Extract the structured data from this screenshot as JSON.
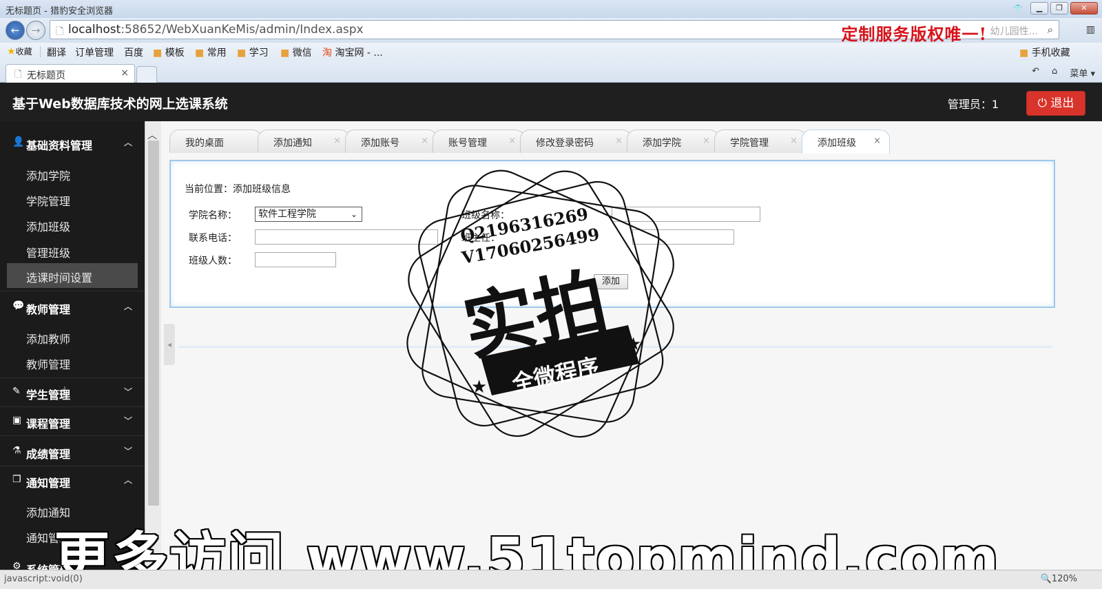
{
  "browser": {
    "window_title": "无标题页 - 猎豹安全浏览器",
    "url_host": "localhost",
    "url_rest": ":58652/WebXuanKeMis/admin/Index.aspx",
    "promo_text": "定制服务版权唯一!",
    "search_hint": "幼儿园性...",
    "favorites": [
      "收藏",
      "翻译",
      "订单管理",
      "百度",
      "模板",
      "常用",
      "学习",
      "微信",
      "淘宝网 - ..."
    ],
    "mobile_fav": "手机收藏",
    "tab_title": "无标题页",
    "menu_label": "菜单",
    "status_text": "javascript:void(0)",
    "zoom": "120%"
  },
  "app": {
    "title": "基于Web数据库技术的网上选课系统",
    "admin_label": "管理员：1",
    "logout_label": "退出"
  },
  "sidebar": {
    "groups": [
      {
        "label": "基础资料管理",
        "icon": "user-icon",
        "items": [
          "添加学院",
          "学院管理",
          "添加班级",
          "管理班级",
          "选课时间设置"
        ]
      },
      {
        "label": "教师管理",
        "icon": "comments-icon",
        "items": [
          "添加教师",
          "教师管理"
        ]
      },
      {
        "label": "学生管理",
        "icon": "edit-icon",
        "items": []
      },
      {
        "label": "课程管理",
        "icon": "image-icon",
        "items": []
      },
      {
        "label": "成绩管理",
        "icon": "flask-icon",
        "items": []
      },
      {
        "label": "通知管理",
        "icon": "copy-icon",
        "items": [
          "添加通知",
          "通知管理"
        ]
      },
      {
        "label": "系统管理",
        "icon": "gear-icon",
        "items": []
      }
    ],
    "active_item": "选课时间设置"
  },
  "tabs": [
    "我的桌面",
    "添加通知",
    "添加账号",
    "账号管理",
    "修改登录密码",
    "添加学院",
    "学院管理",
    "添加班级"
  ],
  "active_tab": "添加班级",
  "form": {
    "breadcrumb": "当前位置：添加班级信息",
    "college_label": "学院名称：",
    "college_value": "软件工程学院",
    "class_name_label": "班级名称：",
    "phone_label": "联系电话：",
    "head_label": "班主任：",
    "count_label": "班级人数：",
    "submit_label": "添加"
  },
  "watermark": {
    "qq": "Q2196316269",
    "v": "V17060256499",
    "big": "实拍",
    "ribbon": "全微程序",
    "bottom": "更多访问 www.51topmind.com"
  }
}
